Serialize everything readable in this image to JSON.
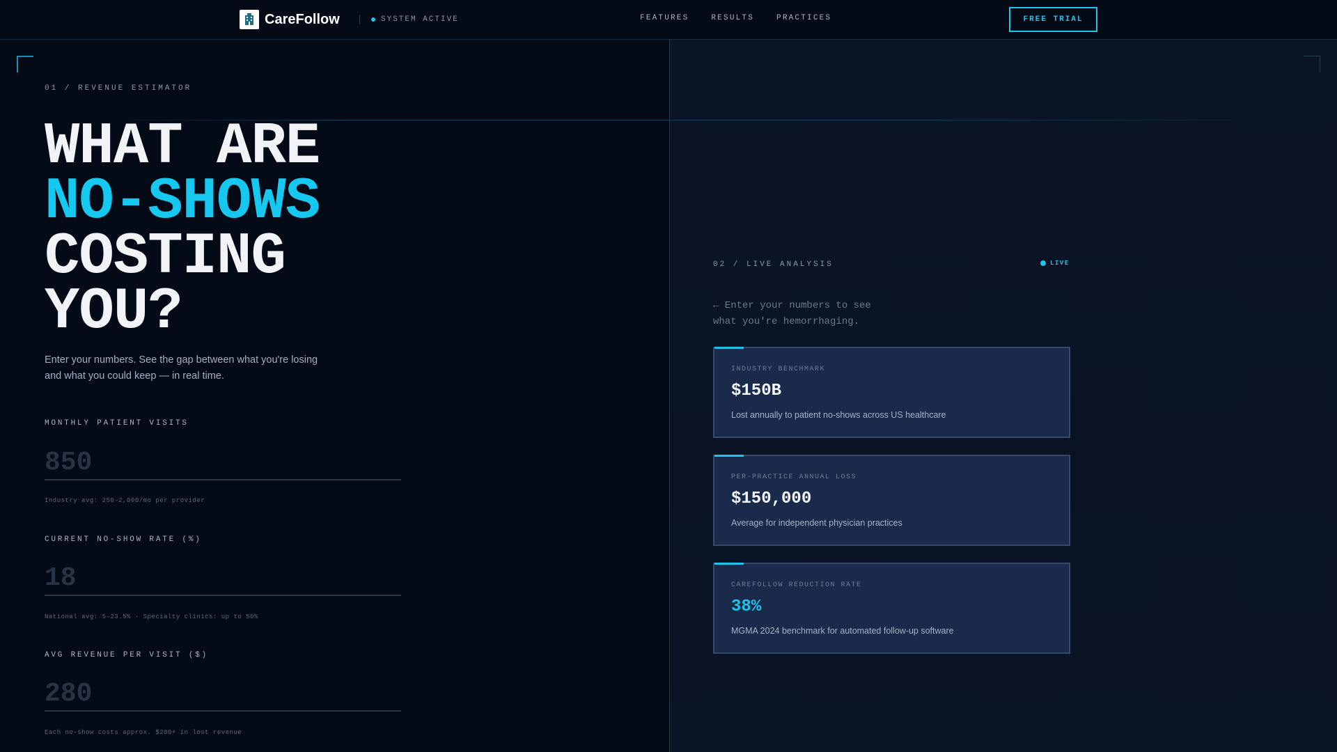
{
  "header": {
    "brand": "CareFollow",
    "status": "SYSTEM ACTIVE",
    "nav": [
      "FEATURES",
      "RESULTS",
      "PRACTICES"
    ],
    "cta": "FREE TRIAL"
  },
  "estimator": {
    "section_label": "01 / REVENUE ESTIMATOR",
    "headline_line1": "WHAT ARE",
    "headline_line2": "NO-SHOWS",
    "headline_line3": "COSTING",
    "headline_line4": "YOU?",
    "subtext": "Enter your numbers. See the gap between what you're losing and what you could keep — in real time.",
    "fields": [
      {
        "label": "MONTHLY PATIENT VISITS",
        "placeholder": "850",
        "hint": "Industry avg: 250–2,000/mo per provider"
      },
      {
        "label": "CURRENT NO-SHOW RATE (%)",
        "placeholder": "18",
        "hint": "National avg: 5–23.5% · Specialty clinics: up to 50%"
      },
      {
        "label": "AVG REVENUE PER VISIT ($)",
        "placeholder": "280",
        "hint": "Each no-show costs approx. $200+ in lost revenue"
      }
    ]
  },
  "analysis": {
    "section_label": "02 / LIVE ANALYSIS",
    "live": "LIVE",
    "hint": "← Enter your numbers to see what you're hemorrhaging.",
    "cards": [
      {
        "label": "INDUSTRY BENCHMARK",
        "value": "$150B",
        "desc": "Lost annually to patient no-shows across US healthcare"
      },
      {
        "label": "PER-PRACTICE ANNUAL LOSS",
        "value": "$150,000",
        "desc": "Average for independent physician practices"
      },
      {
        "label": "CAREFOLLOW REDUCTION RATE",
        "value": "38%",
        "desc": "MGMA 2024 benchmark for automated follow-up software"
      }
    ]
  },
  "colors": {
    "background": "#050b16",
    "accent": "#1fc4ec",
    "card": "#1a2a4a"
  }
}
